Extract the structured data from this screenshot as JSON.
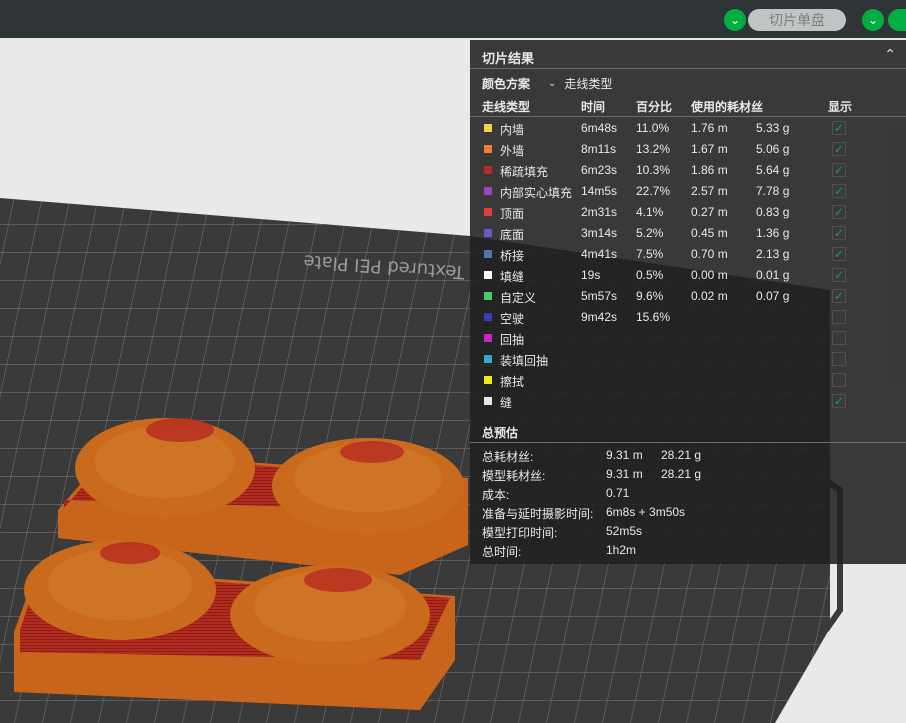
{
  "topbar": {
    "slice_plate_label": "切片单盘"
  },
  "panel": {
    "title": "切片结果",
    "color_scheme_label": "颜色方案",
    "color_scheme_value": "走线类型",
    "columns": [
      "走线类型",
      "时间",
      "百分比",
      "使用的耗材丝",
      "显示"
    ],
    "rows": [
      {
        "color": "#f2d443",
        "name": "内墙",
        "time": "6m48s",
        "pct": "11.0%",
        "len": "1.76 m",
        "weight": "5.33 g",
        "checked": true
      },
      {
        "color": "#f47c38",
        "name": "外墙",
        "time": "8m11s",
        "pct": "13.2%",
        "len": "1.67 m",
        "weight": "5.06 g",
        "checked": true
      },
      {
        "color": "#b22a2a",
        "name": "稀疏填充",
        "time": "6m23s",
        "pct": "10.3%",
        "len": "1.86 m",
        "weight": "5.64 g",
        "checked": true
      },
      {
        "color": "#9b45c2",
        "name": "内部实心填充",
        "time": "14m5s",
        "pct": "22.7%",
        "len": "2.57 m",
        "weight": "7.78 g",
        "checked": true
      },
      {
        "color": "#e33a3a",
        "name": "顶面",
        "time": "2m31s",
        "pct": "4.1%",
        "len": "0.27 m",
        "weight": "0.83 g",
        "checked": true
      },
      {
        "color": "#6b59c9",
        "name": "底面",
        "time": "3m14s",
        "pct": "5.2%",
        "len": "0.45 m",
        "weight": "1.36 g",
        "checked": true
      },
      {
        "color": "#4f74b6",
        "name": "桥接",
        "time": "4m41s",
        "pct": "7.5%",
        "len": "0.70 m",
        "weight": "2.13 g",
        "checked": true
      },
      {
        "color": "#ffffff",
        "name": "填缝",
        "time": "19s",
        "pct": "0.5%",
        "len": "0.00 m",
        "weight": "0.01 g",
        "checked": true
      },
      {
        "color": "#4fc96f",
        "name": "自定义",
        "time": "5m57s",
        "pct": "9.6%",
        "len": "0.02 m",
        "weight": "0.07 g",
        "checked": true
      },
      {
        "color": "#3a3ab2",
        "name": "空驶",
        "time": "9m42s",
        "pct": "15.6%",
        "len": "",
        "weight": "",
        "checked": false
      },
      {
        "color": "#c52bc5",
        "name": "回抽",
        "time": "",
        "pct": "",
        "len": "",
        "weight": "",
        "checked": false
      },
      {
        "color": "#37a8c9",
        "name": "装填回抽",
        "time": "",
        "pct": "",
        "len": "",
        "weight": "",
        "checked": false
      },
      {
        "color": "#f2e81a",
        "name": "擦拭",
        "time": "",
        "pct": "",
        "len": "",
        "weight": "",
        "checked": false
      },
      {
        "color": "#e8e8e8",
        "name": "缝",
        "time": "",
        "pct": "",
        "len": "",
        "weight": "",
        "checked": true
      }
    ],
    "summary_title": "总预估",
    "summary": [
      {
        "label": "总耗材丝:",
        "v1": "9.31 m",
        "v2": "28.21 g"
      },
      {
        "label": "模型耗材丝:",
        "v1": "9.31 m",
        "v2": "28.21 g"
      },
      {
        "label": "成本:",
        "v1": "0.71",
        "v2": ""
      },
      {
        "label": "准备与延时摄影时间:",
        "v1": "6m8s + 3m50s",
        "v2": ""
      },
      {
        "label": "模型打印时间:",
        "v1": "52m5s",
        "v2": ""
      },
      {
        "label": "总时间:",
        "v1": "1h2m",
        "v2": ""
      }
    ]
  },
  "bed_text": "Textured PEI Plate",
  "colors": {
    "accent": "#00ae42",
    "panel_bg": "#202020",
    "model_orange": "#c8641c",
    "model_red": "#b52a1f",
    "bed": "#3c3c3c"
  }
}
